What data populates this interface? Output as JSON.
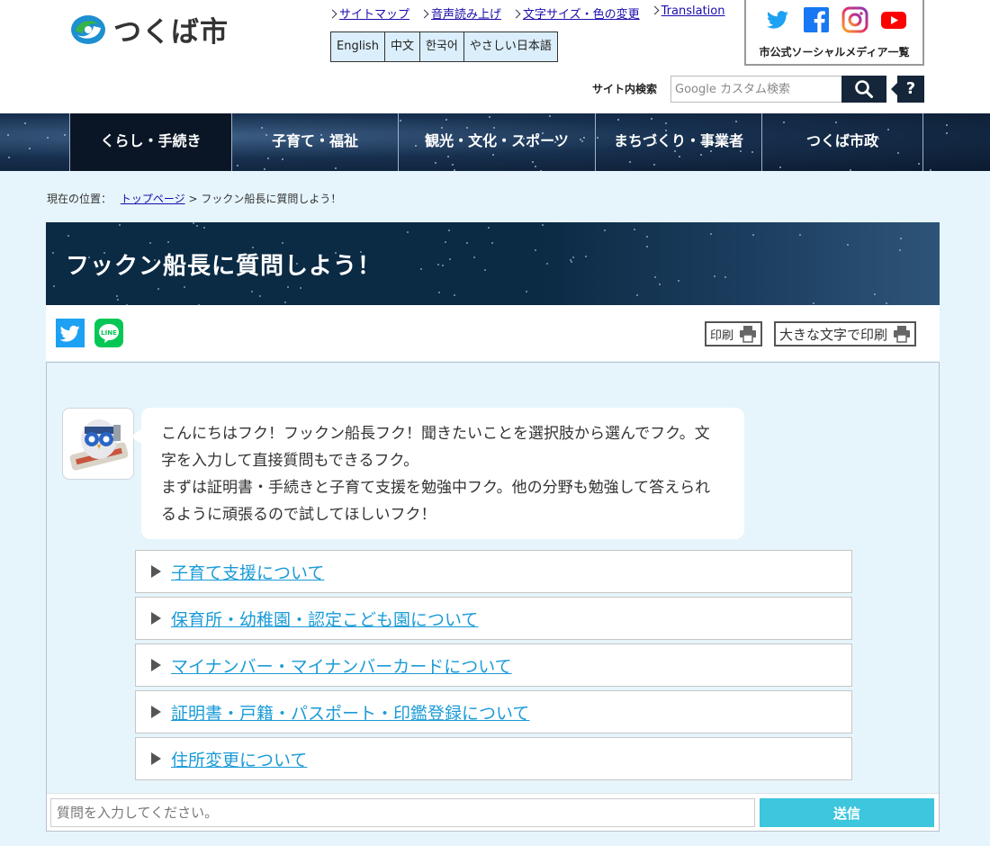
{
  "header": {
    "logo_text": "つくば市",
    "util_links": [
      "サイトマップ",
      "音声読み上げ",
      "文字サイズ・色の変更",
      "Translation"
    ],
    "languages": [
      "English",
      "中文",
      "한국어",
      "やさしい日本語"
    ],
    "social_caption": "市公式ソーシャルメディア一覧",
    "social_icons": [
      "twitter-icon",
      "facebook-icon",
      "instagram-icon",
      "youtube-icon"
    ],
    "search_label": "サイト内検索",
    "search_placeholder": "Google カスタム検索",
    "help_label": "?"
  },
  "nav": {
    "items": [
      "くらし・手続き",
      "子育て・福祉",
      "観光・文化・スポーツ",
      "まちづくり・事業者",
      "つくば市政"
    ],
    "active_index": 0
  },
  "breadcrumb": {
    "prefix": "現在の位置：",
    "home": "トップページ",
    "separator": ">",
    "current": "フックン船長に質問しよう！"
  },
  "page": {
    "title": "フックン船長に質問しよう！"
  },
  "share": {
    "print_label": "印刷",
    "print_large_label": "大きな文字で印刷"
  },
  "chat": {
    "message": "こんにちはフク！フックン船長フク！聞きたいことを選択肢から選んでフク。文字を入力して直接質問もできるフク。\nまずは証明書・手続きと子育て支援を勉強中フク。他の分野も勉強して答えられるように頑張るので試してほしいフク！",
    "options": [
      "子育て支援について",
      "保育所・幼稚園・認定こども園について",
      "マイナンバー・マイナンバーカードについて",
      "証明書・戸籍・パスポート・印鑑登録について",
      "住所変更について"
    ],
    "input_placeholder": "質問を入力してください。",
    "send_label": "送信"
  },
  "colors": {
    "nav_bg": "#17304f",
    "title_bg": "#0b2a44",
    "main_bg": "#e6f5fc",
    "link": "#1a9bd7",
    "send": "#3dc6dd"
  }
}
